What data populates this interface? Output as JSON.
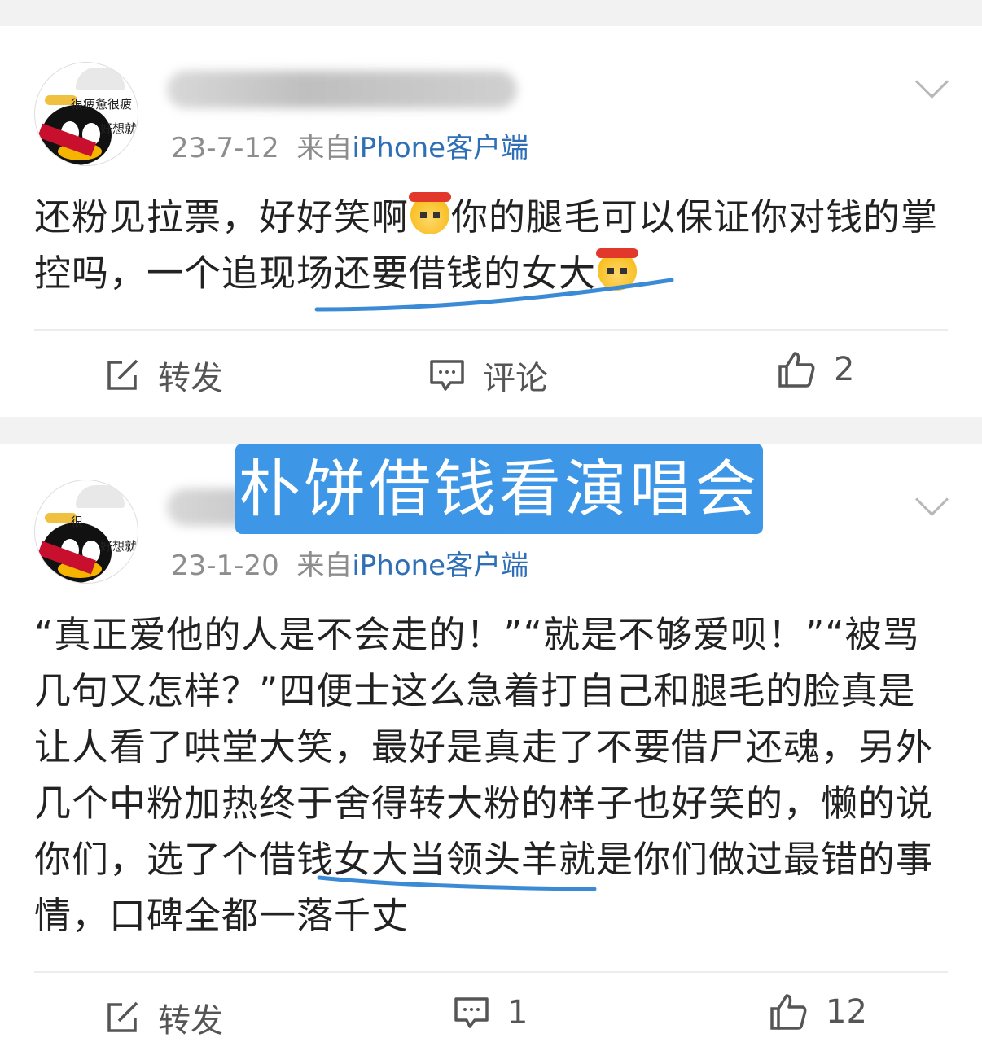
{
  "posts": [
    {
      "avatar_text": [
        "很疲惫很疲",
        "好想就"
      ],
      "date": "23-7-12",
      "from": "来自",
      "source": "iPhone客户端",
      "content_a": "还粉见拉票，好好笑啊",
      "content_b": "你的腿毛可以保证你对钱的掌控吗，一个追现场还要借钱的女大",
      "repost_label": "转发",
      "comment_label": "评论",
      "like_count": "2"
    },
    {
      "avatar_text": [
        "很",
        "好想就"
      ],
      "date": "23-1-20",
      "from": "来自",
      "source": "iPhone客户端",
      "content": "“真正爱他的人是不会走的！”“就是不够爱呗！”“被骂几句又怎样？”四便士这么急着打自己和腿毛的脸真是让人看了哄堂大笑，最好是真走了不要借尸还魂，另外几个中粉加热终于舍得转大粉的样子也好笑的，懒的说你们，选了个借钱女大当领头羊就是你们做过最错的事情，口碑全都一落千丈",
      "repost_label": "转发",
      "comment_count": "1",
      "like_count": "12"
    }
  ],
  "overlay_banner": "朴饼借钱看演唱会",
  "colors": {
    "link": "#2e6fb5",
    "banner": "#3d97e6",
    "underline": "#3a8ad6"
  }
}
